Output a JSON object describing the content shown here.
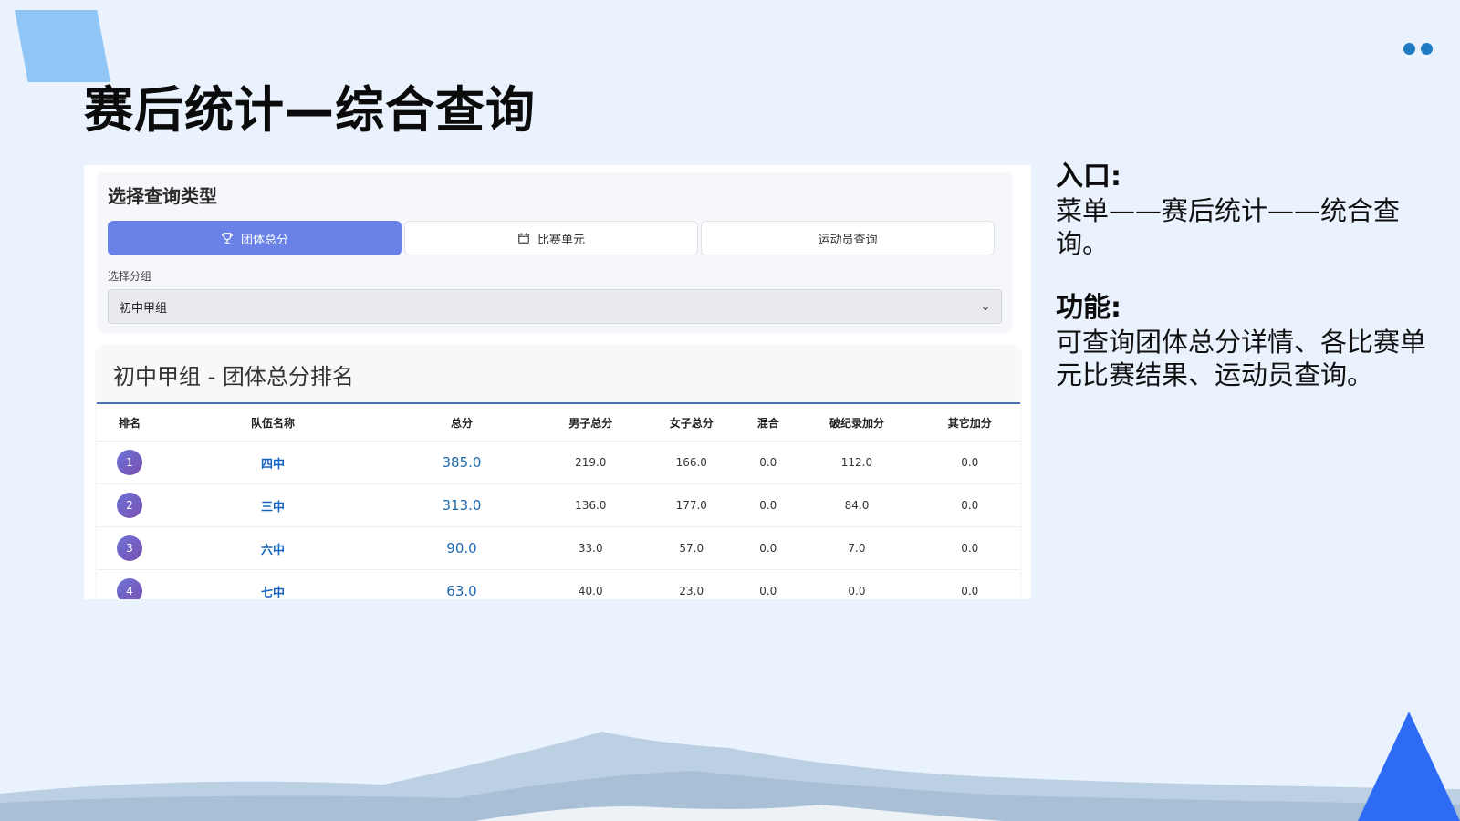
{
  "slide": {
    "title": "赛后统计—综合查询",
    "entry_heading": "入口:",
    "entry_text": "菜单——赛后统计——统合查询。",
    "function_heading": "功能:",
    "function_text": "可查询团体总分详情、各比赛单元比赛结果、运动员查询。"
  },
  "query": {
    "section_title": "选择查询类型",
    "buttons": [
      {
        "label": "团体总分",
        "icon": "trophy-icon",
        "active": true
      },
      {
        "label": "比赛单元",
        "icon": "calendar-icon",
        "active": false
      },
      {
        "label": "运动员查询",
        "icon": "",
        "active": false
      }
    ],
    "group_label": "选择分组",
    "group_value": "初中甲组"
  },
  "ranking": {
    "title": "初中甲组 - 团体总分排名",
    "columns": [
      "排名",
      "队伍名称",
      "总分",
      "男子总分",
      "女子总分",
      "混合",
      "破纪录加分",
      "其它加分"
    ],
    "rows": [
      {
        "rank": "1",
        "team": "四中",
        "total": "385.0",
        "male": "219.0",
        "female": "166.0",
        "mixed": "0.0",
        "record": "112.0",
        "other": "0.0"
      },
      {
        "rank": "2",
        "team": "三中",
        "total": "313.0",
        "male": "136.0",
        "female": "177.0",
        "mixed": "0.0",
        "record": "84.0",
        "other": "0.0"
      },
      {
        "rank": "3",
        "team": "六中",
        "total": "90.0",
        "male": "33.0",
        "female": "57.0",
        "mixed": "0.0",
        "record": "7.0",
        "other": "0.0"
      },
      {
        "rank": "4",
        "team": "七中",
        "total": "63.0",
        "male": "40.0",
        "female": "23.0",
        "mixed": "0.0",
        "record": "0.0",
        "other": "0.0"
      }
    ]
  },
  "colors": {
    "background": "#eaf2fd",
    "accent": "#2e6bf5",
    "active_button": "#6a82e8",
    "team_link": "#1565c0"
  }
}
